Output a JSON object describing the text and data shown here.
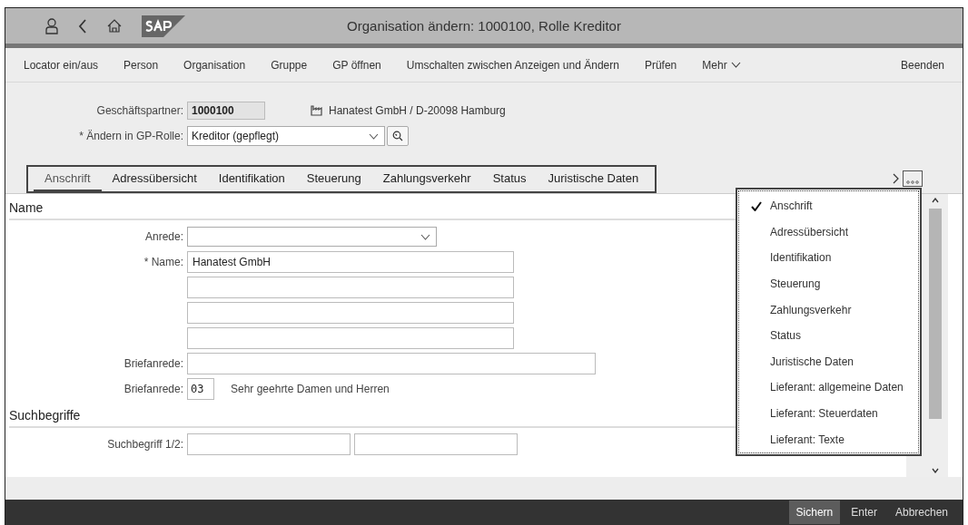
{
  "window": {
    "title": "Organisation ändern: 1000100, Rolle Kreditor"
  },
  "toolbar": {
    "items": [
      "Locator ein/aus",
      "Person",
      "Organisation",
      "Gruppe",
      "GP öffnen",
      "Umschalten zwischen Anzeigen und Ändern",
      "Prüfen"
    ],
    "more": "Mehr",
    "exit": "Beenden"
  },
  "header": {
    "partner_label": "Geschäftspartner:",
    "partner_value": "1000100",
    "partner_description": "Hanatest GmbH / D-20098 Hamburg",
    "role_label": "* Ändern in GP-Rolle:",
    "role_value": "Kreditor (gepflegt)"
  },
  "tabs": [
    {
      "label": "Anschrift",
      "selected": true
    },
    {
      "label": "Adressübersicht",
      "selected": false
    },
    {
      "label": "Identifikation",
      "selected": false
    },
    {
      "label": "Steuerung",
      "selected": false
    },
    {
      "label": "Zahlungsverkehr",
      "selected": false
    },
    {
      "label": "Status",
      "selected": false
    },
    {
      "label": "Juristische Daten",
      "selected": false
    }
  ],
  "sections": [
    {
      "title": "Name",
      "rows": [
        {
          "label": "Anrede:",
          "fields": [
            {
              "kind": "select"
            }
          ]
        },
        {
          "label": "* Name:",
          "fields": [
            {
              "kind": "input",
              "value": "Hanatest GmbH"
            }
          ]
        },
        {
          "fields": [
            {
              "kind": "input"
            }
          ]
        },
        {
          "fields": [
            {
              "kind": "input"
            }
          ]
        },
        {
          "fields": [
            {
              "kind": "input"
            }
          ]
        },
        {
          "label": "Briefanrede:",
          "fields": [
            {
              "kind": "input"
            }
          ]
        },
        {
          "label": "Briefanrede:",
          "fields": [
            {
              "kind": "input",
              "value": "03"
            },
            {
              "kind": "text",
              "value": "Sehr geehrte Damen und Herren"
            }
          ]
        }
      ]
    },
    {
      "title": "Suchbegriffe",
      "rows": [
        {
          "label": "Suchbegriff 1/2:",
          "fields": [
            {
              "kind": "input"
            },
            {
              "kind": "input"
            }
          ]
        }
      ]
    }
  ],
  "tab_menu": [
    {
      "label": "Anschrift",
      "checked": true
    },
    {
      "label": "Adressübersicht",
      "checked": false
    },
    {
      "label": "Identifikation",
      "checked": false
    },
    {
      "label": "Steuerung",
      "checked": false
    },
    {
      "label": "Zahlungsverkehr",
      "checked": false
    },
    {
      "label": "Status",
      "checked": false
    },
    {
      "label": "Juristische Daten",
      "checked": false
    },
    {
      "label": "Lieferant: allgemeine Daten",
      "checked": false
    },
    {
      "label": "Lieferant: Steuerdaten",
      "checked": false
    },
    {
      "label": "Lieferant: Texte",
      "checked": false
    }
  ],
  "footer": [
    {
      "label": "Sichern",
      "kind": "primary"
    },
    {
      "label": "Enter",
      "kind": "plain"
    },
    {
      "label": "Abbrechen",
      "kind": "plain"
    }
  ]
}
